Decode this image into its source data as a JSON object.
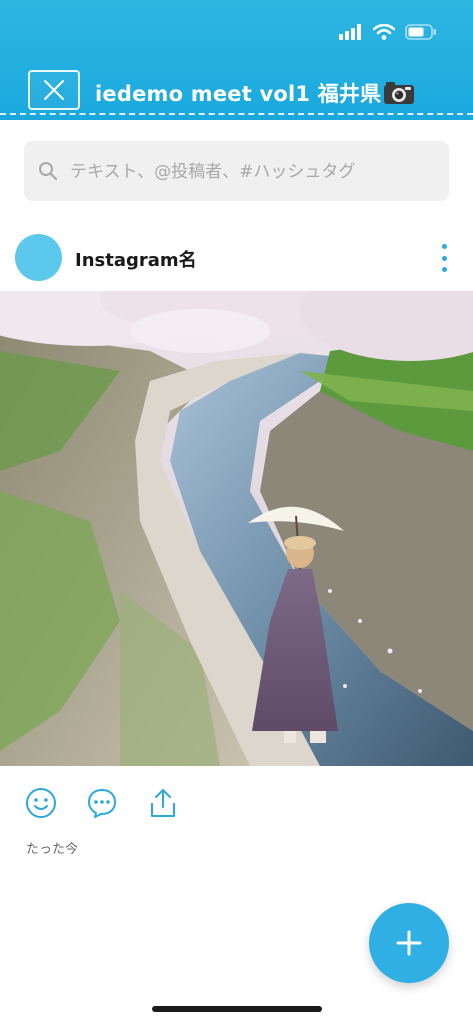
{
  "header": {
    "title": "iedemo meet vol1 福井県",
    "close_icon": "close-icon",
    "title_icon": "camera-icon",
    "background_color": "#22aee0"
  },
  "status_bar": {
    "icons": [
      "signal-icon",
      "wifi-icon",
      "battery-icon"
    ]
  },
  "search": {
    "placeholder": "テキスト、@投稿者、#ハッシュタグ",
    "value": "",
    "icon": "search-icon"
  },
  "post": {
    "username": "Instagram名",
    "avatar_color": "#5cc8eb",
    "menu_icon": "more-vertical-icon",
    "image": "photo of a woman with a white parasol by a river lined with cherry blossoms",
    "actions": [
      {
        "name": "reaction-button",
        "icon": "smiley-icon"
      },
      {
        "name": "comment-button",
        "icon": "comment-icon"
      },
      {
        "name": "share-button",
        "icon": "share-icon"
      }
    ],
    "timestamp": "たった今"
  },
  "fab": {
    "icon": "plus-icon",
    "color": "#2fafe3"
  }
}
